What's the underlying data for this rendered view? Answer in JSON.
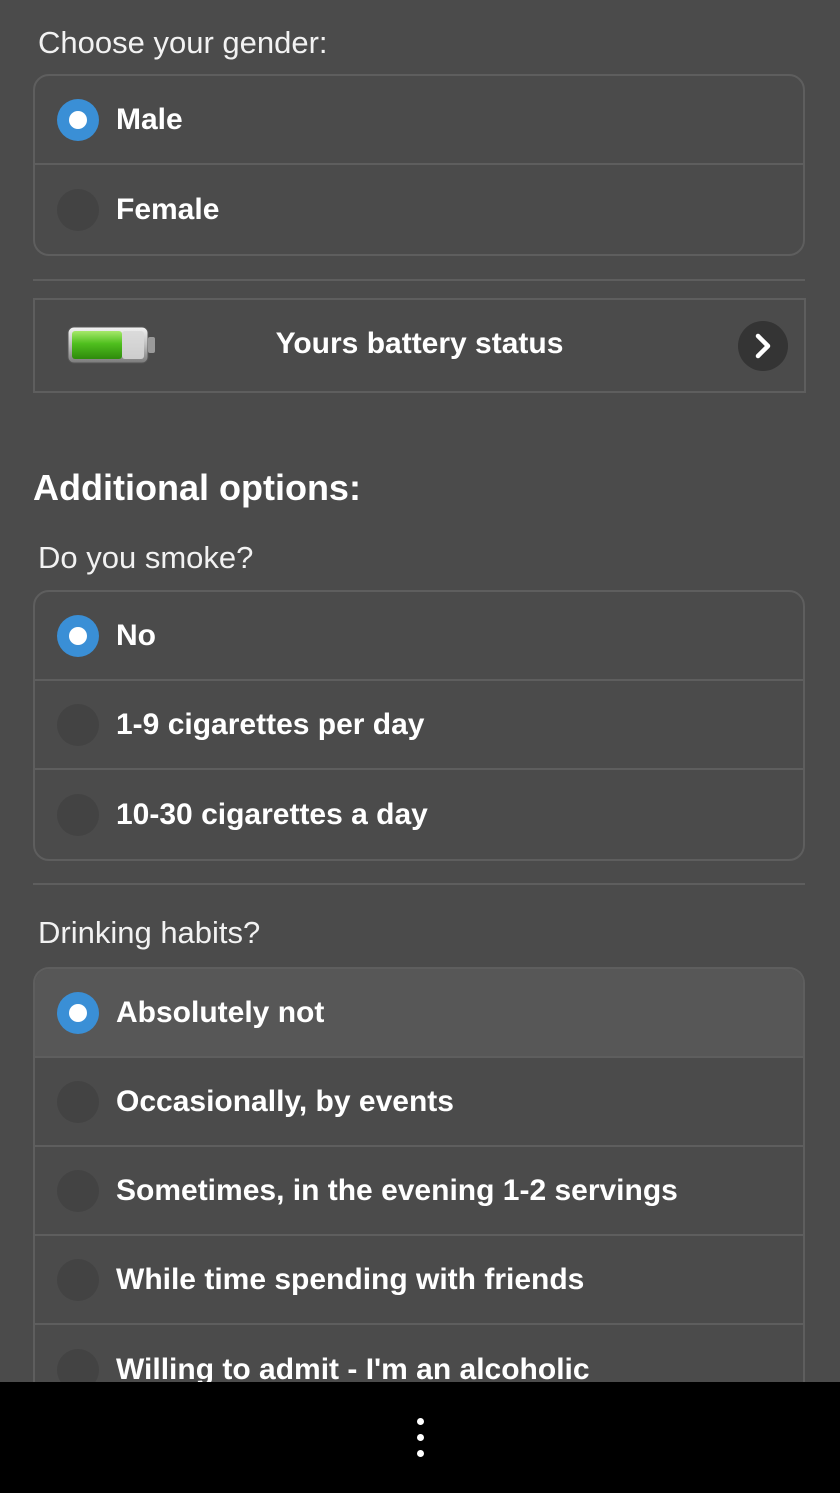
{
  "gender": {
    "label": "Choose your gender:",
    "options": [
      {
        "label": "Male",
        "checked": true
      },
      {
        "label": "Female",
        "checked": false
      }
    ]
  },
  "battery": {
    "label": "Yours battery status",
    "icon": "battery-icon",
    "action_icon": "chevron-right-icon"
  },
  "additional": {
    "heading": "Additional options:"
  },
  "smoke": {
    "label": "Do you smoke?",
    "options": [
      {
        "label": "No",
        "checked": true
      },
      {
        "label": "1-9 cigarettes per day",
        "checked": false
      },
      {
        "label": "10-30 cigarettes a day",
        "checked": false
      }
    ]
  },
  "drinking": {
    "label": "Drinking habits?",
    "options": [
      {
        "label": "Absolutely not",
        "checked": true
      },
      {
        "label": "Occasionally, by events",
        "checked": false
      },
      {
        "label": "Sometimes, in the evening 1-2 servings",
        "checked": false
      },
      {
        "label": "While time spending with friends",
        "checked": false
      },
      {
        "label": "Willing to admit - I'm an alcoholic",
        "checked": false
      }
    ]
  },
  "navbar": {
    "menu_icon": "overflow-menu-icon"
  },
  "colors": {
    "background": "#4b4b4b",
    "radio_checked": "#3a8fd6",
    "border": "#5e5e5e",
    "navbar": "#000000"
  }
}
